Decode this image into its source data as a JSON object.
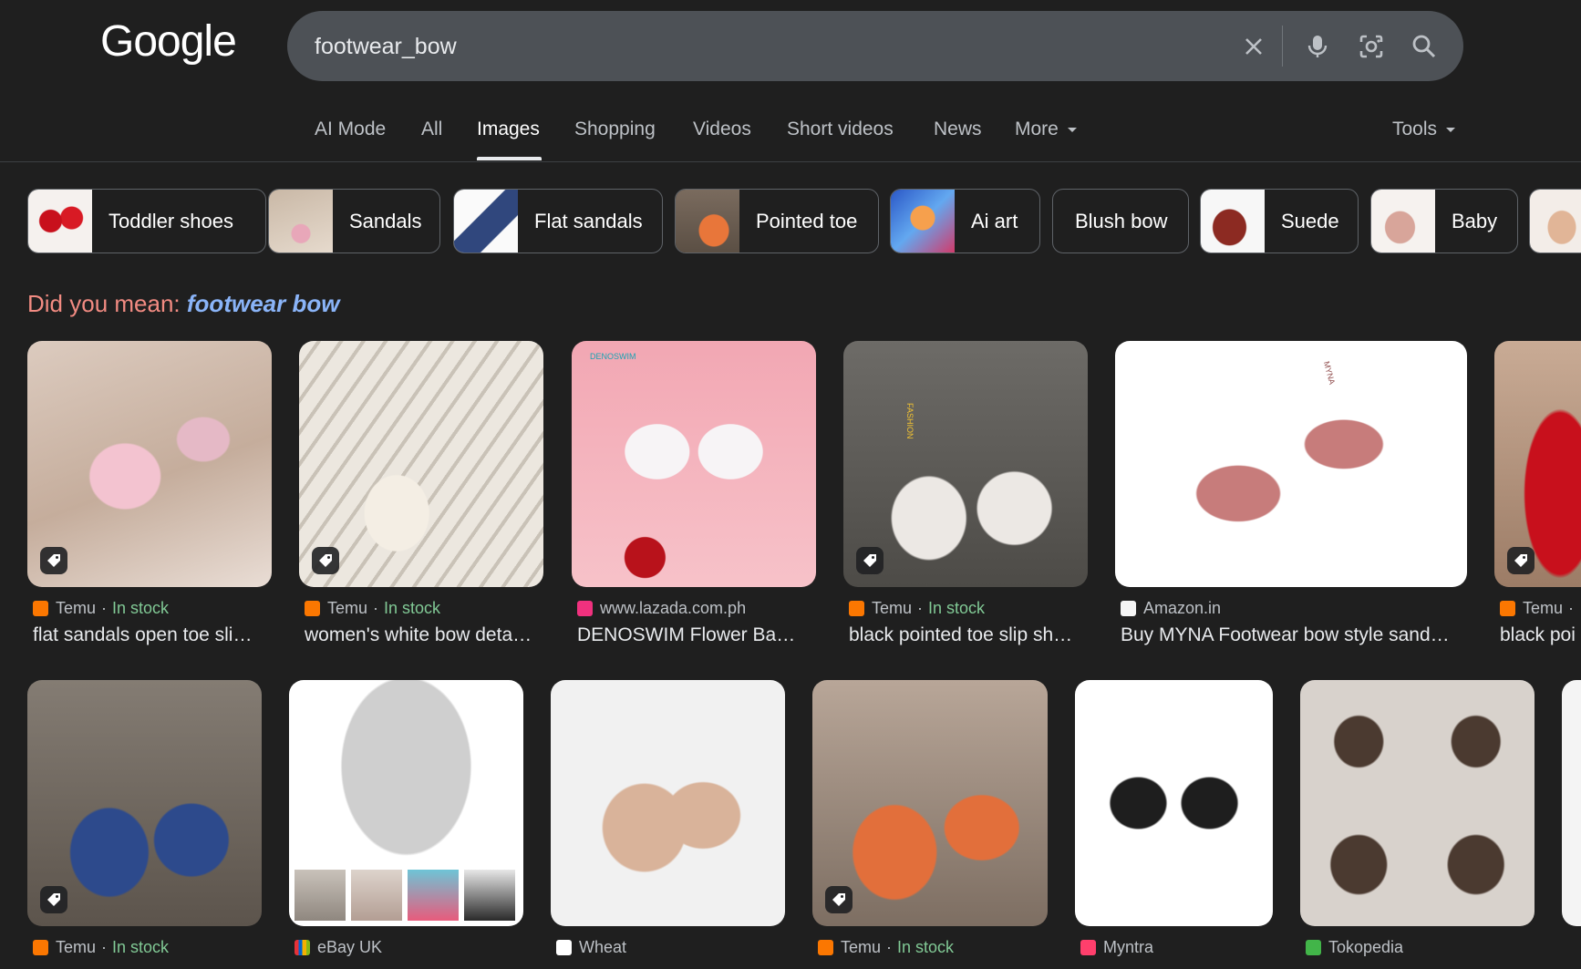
{
  "logo": "Google",
  "search": {
    "query": "footwear_bow"
  },
  "tabs": [
    "AI Mode",
    "All",
    "Images",
    "Shopping",
    "Videos",
    "Short videos",
    "News",
    "More"
  ],
  "tools": "Tools",
  "chips": [
    "Toddler shoes",
    "Sandals",
    "Flat sandals",
    "Pointed toe",
    "Ai art",
    "Blush bow",
    "Suede",
    "Baby"
  ],
  "did_you_mean": {
    "prefix": "Did you mean:",
    "suggestion": "footwear bow"
  },
  "row1": [
    {
      "source": "Temu",
      "stock": "In stock",
      "title": "flat sandals open toe sli…"
    },
    {
      "source": "Temu",
      "stock": "In stock",
      "title": "women's white bow deta…"
    },
    {
      "source": "www.lazada.com.ph",
      "stock": "",
      "title": "DENOSWIM Flower Ba…"
    },
    {
      "source": "Temu",
      "stock": "In stock",
      "title": "black pointed toe slip sh…"
    },
    {
      "source": "Amazon.in",
      "stock": "",
      "title": "Buy MYNA Footwear bow style sand…"
    },
    {
      "source": "Temu",
      "stock": "",
      "title": "black poi"
    }
  ],
  "row2": [
    {
      "source": "Temu",
      "stock": "In stock"
    },
    {
      "source": "eBay UK",
      "stock": ""
    },
    {
      "source": "Wheat",
      "stock": ""
    },
    {
      "source": "Temu",
      "stock": "In stock"
    },
    {
      "source": "Myntra",
      "stock": ""
    },
    {
      "source": "Tokopedia",
      "stock": ""
    }
  ],
  "watermarks": {
    "denoswim": "DENOSWIM",
    "fashion": "FASHION",
    "myna": "MYNA"
  },
  "colors": {
    "background": "#1f1f1f",
    "link": "#8ab4f8",
    "did_you_mean": "#f28b82",
    "in_stock": "#81c995"
  }
}
